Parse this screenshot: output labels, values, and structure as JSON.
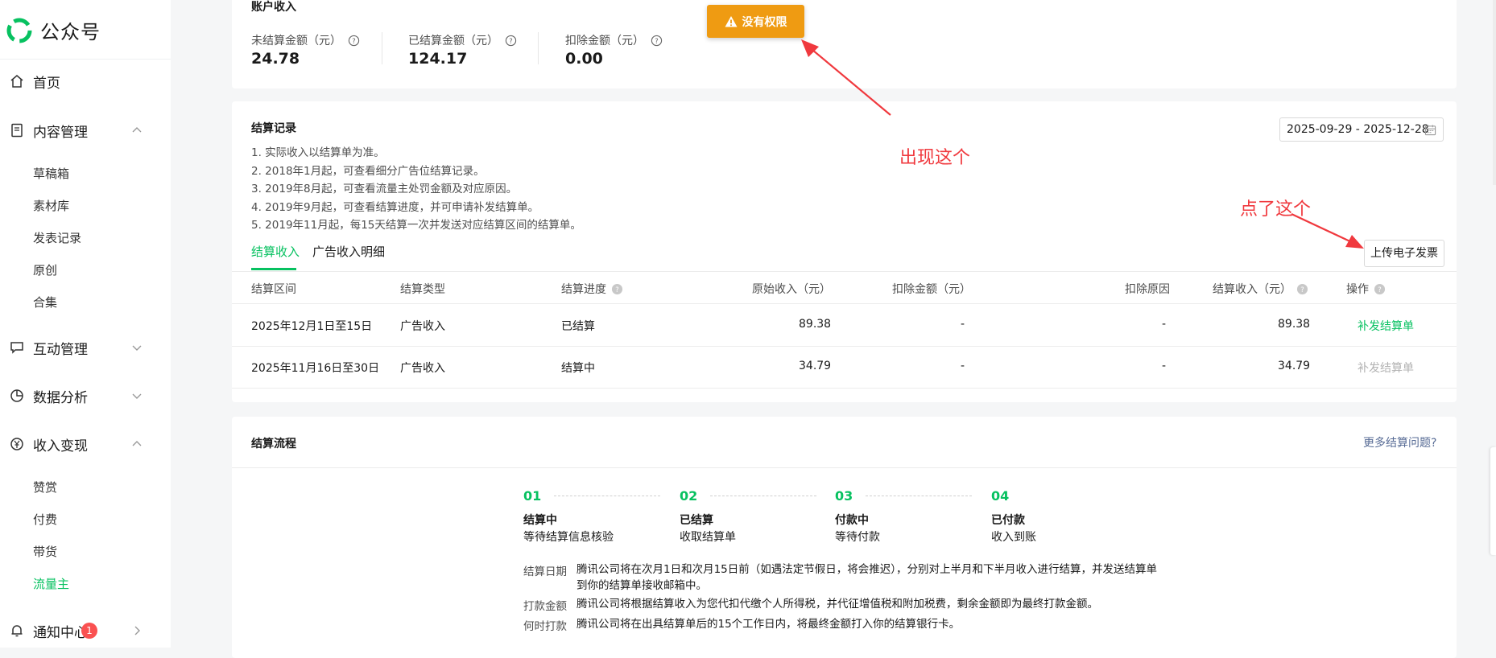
{
  "brand": {
    "name": "公众号"
  },
  "sidebar": {
    "home": "首页",
    "content": {
      "label": "内容管理",
      "items": [
        "草稿箱",
        "素材库",
        "发表记录",
        "原创",
        "合集"
      ]
    },
    "interaction": "互动管理",
    "analytics": "数据分析",
    "monetization": {
      "label": "收入变现",
      "items": [
        "赞赏",
        "付费",
        "带货",
        "流量主"
      ],
      "active": "流量主"
    },
    "notifications": {
      "label": "通知中心",
      "badge": "1"
    }
  },
  "account": {
    "title": "账户收入",
    "stats": [
      {
        "label": "未结算金额（元）",
        "value": "24.78"
      },
      {
        "label": "已结算金额（元）",
        "value": "124.17"
      },
      {
        "label": "扣除金额（元）",
        "value": "0.00"
      }
    ]
  },
  "toast": {
    "text": "没有权限",
    "color": "#ef9b12"
  },
  "settlement": {
    "title": "结算记录",
    "notes": [
      "1. 实际收入以结算单为准。",
      "2. 2018年1月起，可查看细分广告位结算记录。",
      "3. 2019年8月起，可查看流量主处罚金额及对应原因。",
      "4. 2019年9月起，可查看结算进度，并可申请补发结算单。",
      "5. 2019年11月起，每15天结算一次并发送对应结算区间的结算单。"
    ],
    "date_range": "2025-09-29 - 2025-12-28",
    "tabs": [
      "结算收入",
      "广告收入明细"
    ],
    "upload_button": "上传电子发票",
    "columns": [
      "结算区间",
      "结算类型",
      "结算进度",
      "原始收入（元）",
      "扣除金额（元）",
      "扣除原因",
      "结算收入（元）",
      "操作"
    ],
    "rows": [
      {
        "period": "2025年12月1日至15日",
        "type": "广告收入",
        "progress": "已结算",
        "original": "89.38",
        "deduction": "-",
        "reason": "-",
        "income": "89.38",
        "action": "补发结算单",
        "action_enabled": true
      },
      {
        "period": "2025年11月16日至30日",
        "type": "广告收入",
        "progress": "结算中",
        "original": "34.79",
        "deduction": "-",
        "reason": "-",
        "income": "34.79",
        "action": "补发结算单",
        "action_enabled": false
      }
    ]
  },
  "process": {
    "title": "结算流程",
    "more_link": "更多结算问题?",
    "steps": [
      {
        "num": "01",
        "title": "结算中",
        "desc": "等待结算信息核验"
      },
      {
        "num": "02",
        "title": "已结算",
        "desc": "收取结算单"
      },
      {
        "num": "03",
        "title": "付款中",
        "desc": "等待付款"
      },
      {
        "num": "04",
        "title": "已付款",
        "desc": "收入到账"
      }
    ],
    "info": [
      {
        "label": "结算日期",
        "text": "腾讯公司将在次月1日和次月15日前（如遇法定节假日，将会推迟），分别对上半月和下半月收入进行结算，并发送结算单到你的结算单接收邮箱中。"
      },
      {
        "label": "打款金额",
        "text": "腾讯公司将根据结算收入为您代扣代缴个人所得税，并代征增值税和附加税费，剩余金额即为最终打款金额。"
      },
      {
        "label": "何时打款",
        "text": "腾讯公司将在出具结算单后的15个工作日内，将最终金额打入你的结算银行卡。"
      }
    ]
  },
  "annotations": {
    "appeared": "出现这个",
    "clicked": "点了这个",
    "color": "#f0393e"
  },
  "colors": {
    "accent": "#07c160",
    "link": "#576b95",
    "danger": "#fa5151"
  }
}
